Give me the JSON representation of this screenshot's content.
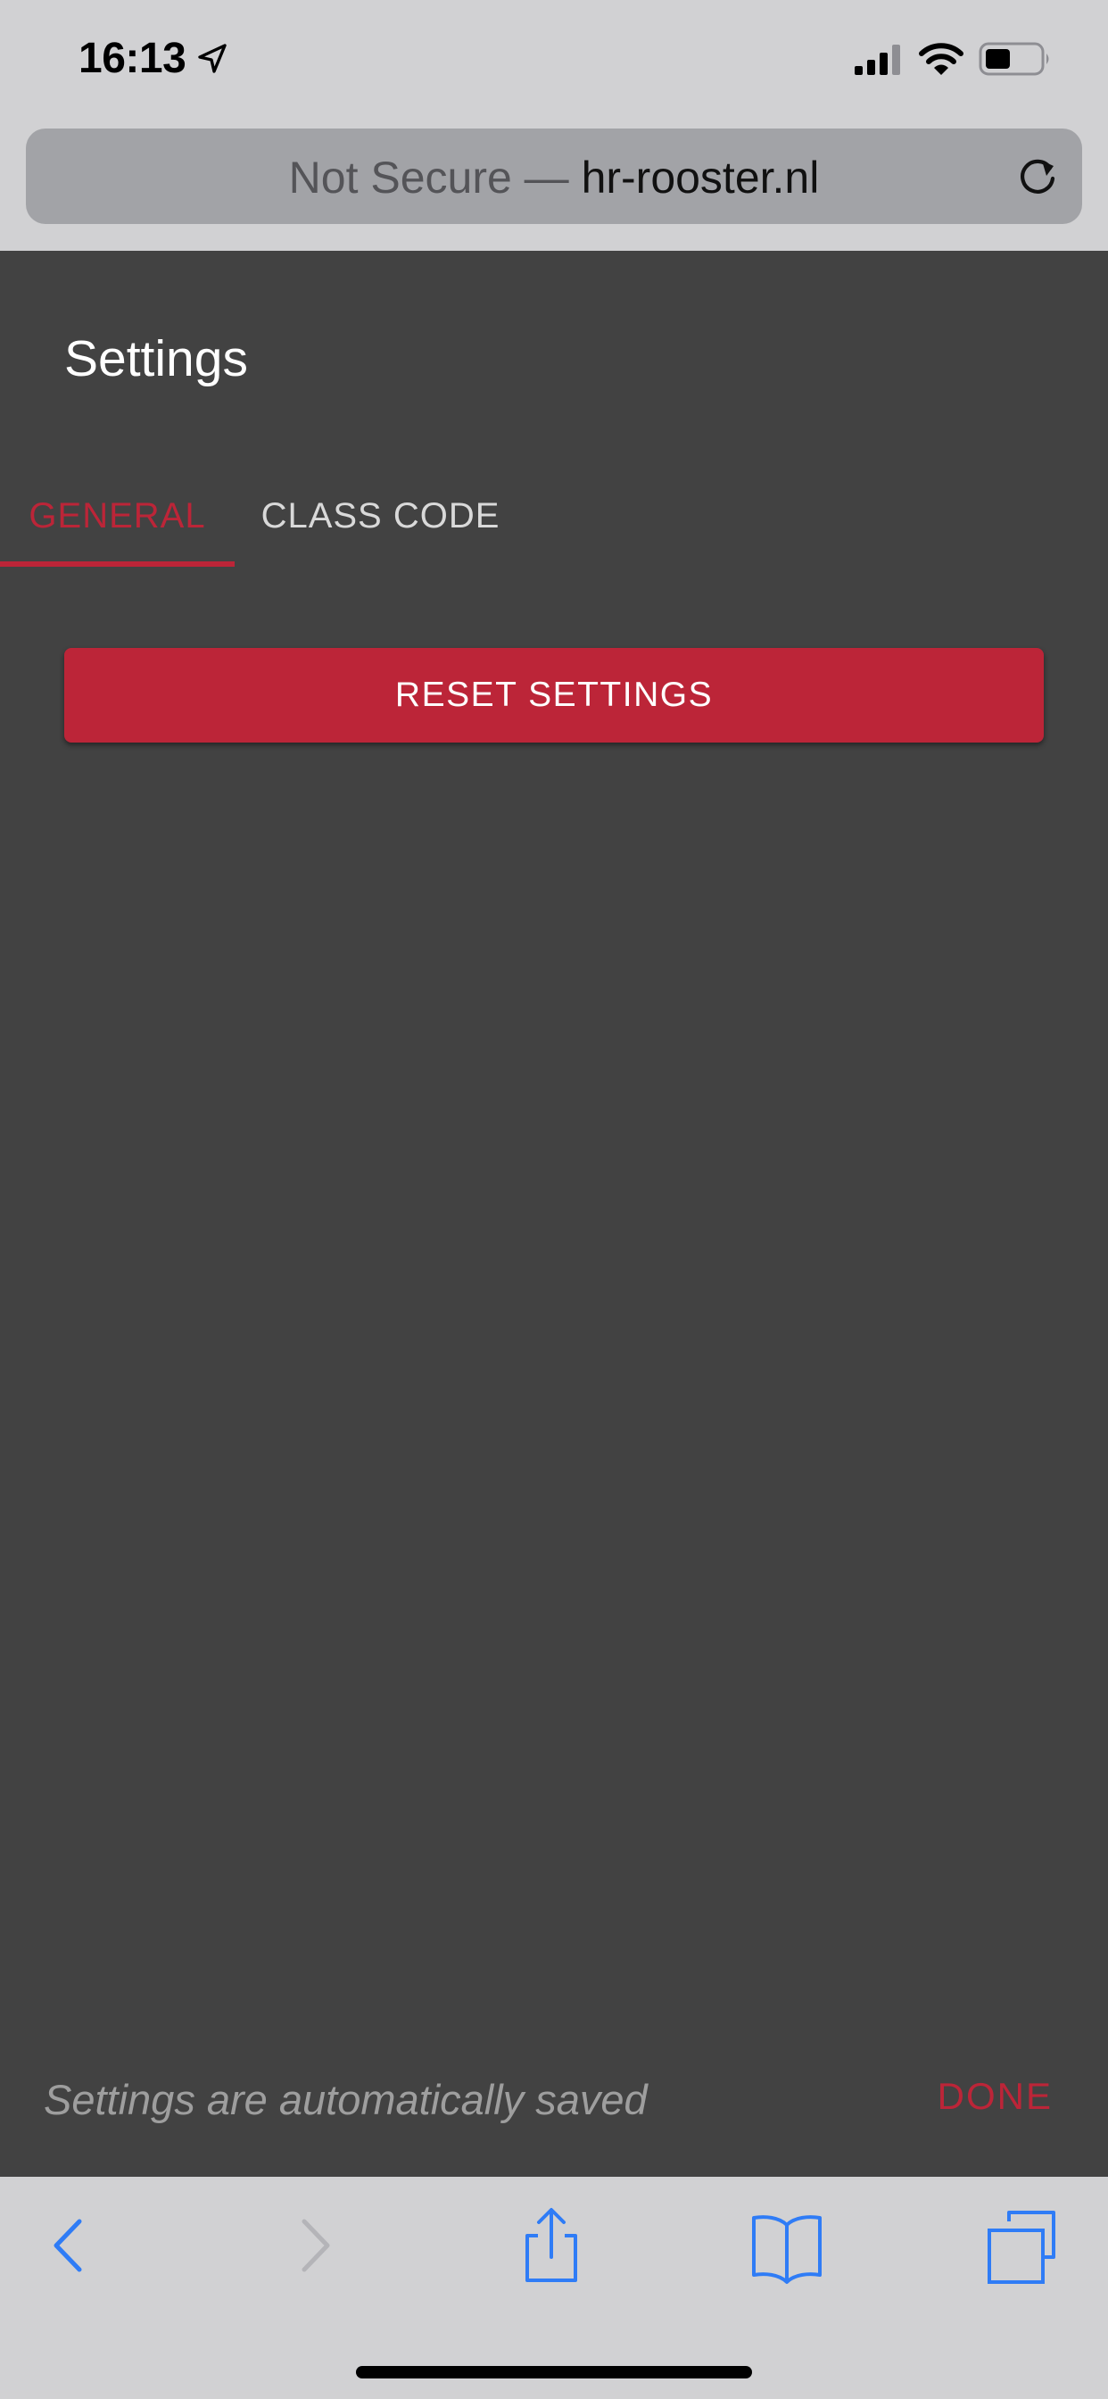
{
  "status_bar": {
    "time": "16:13",
    "icons": [
      "location-arrow-icon",
      "cellular-signal-icon",
      "wifi-icon",
      "battery-icon"
    ]
  },
  "browser": {
    "url_prefix": "Not Secure — ",
    "url_host": "hr-rooster.nl",
    "reload_icon": "reload-icon"
  },
  "settings": {
    "title": "Settings",
    "tabs": [
      {
        "label": "GENERAL",
        "active": true
      },
      {
        "label": "CLASS CODE",
        "active": false
      }
    ],
    "reset_label": "RESET SETTINGS",
    "footer_note": "Settings are automatically saved",
    "done_label": "DONE"
  },
  "toolbar": {
    "icons": [
      "back-icon",
      "forward-icon",
      "share-icon",
      "bookmarks-icon",
      "tabs-icon"
    ]
  },
  "colors": {
    "accent": "#bc2538",
    "content_background": "#424242",
    "chrome_background": "#d1d1d3",
    "url_bar_background": "#a2a3a7",
    "ios_blue": "#2f7cf6"
  }
}
